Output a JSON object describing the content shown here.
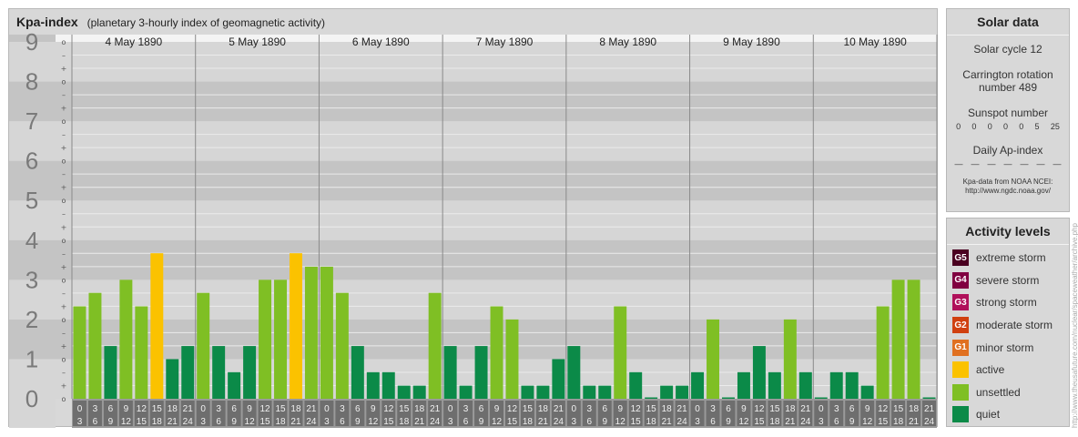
{
  "title": {
    "main": "Kpa-index",
    "sub": "(planetary 3-hourly index of geomagnetic activity)"
  },
  "chart_data": {
    "type": "bar",
    "y_major_labels": [
      "0",
      "1",
      "2",
      "3",
      "4",
      "5",
      "6",
      "7",
      "8",
      "9"
    ],
    "y_minor_labels": [
      "o",
      "+",
      "–"
    ],
    "ylim": [
      0,
      9
    ],
    "days": [
      "4 May 1890",
      "5 May 1890",
      "6 May 1890",
      "7 May 1890",
      "8 May 1890",
      "9 May 1890",
      "10 May 1890"
    ],
    "interval_labels": [
      [
        "0",
        "3"
      ],
      [
        "3",
        "6"
      ],
      [
        "6",
        "9"
      ],
      [
        "9",
        "12"
      ],
      [
        "12",
        "15"
      ],
      [
        "15",
        "18"
      ],
      [
        "18",
        "21"
      ],
      [
        "21",
        "24"
      ]
    ],
    "values": [
      [
        2.33,
        2.67,
        1.33,
        3.0,
        2.33,
        3.67,
        1.0,
        1.33
      ],
      [
        2.67,
        1.33,
        0.67,
        1.33,
        3.0,
        3.0,
        3.67,
        3.33
      ],
      [
        3.33,
        2.67,
        1.33,
        0.67,
        0.67,
        0.33,
        0.33,
        2.67
      ],
      [
        1.33,
        0.33,
        1.33,
        2.33,
        2.0,
        0.33,
        0.33,
        1.0
      ],
      [
        1.33,
        0.33,
        0.33,
        2.33,
        0.67,
        0.0,
        0.33,
        0.33
      ],
      [
        0.67,
        2.0,
        0.0,
        0.67,
        1.33,
        0.67,
        2.0,
        0.67
      ],
      [
        0.0,
        0.67,
        0.67,
        0.33,
        2.33,
        3.0,
        3.0,
        0.0
      ]
    ],
    "level_colors": {
      "quiet": "#0b8a48",
      "unsettled": "#7fbf24",
      "active": "#fbc200",
      "G1": "#e07020",
      "G2": "#d04010",
      "G3": "#b0105a",
      "G4": "#800040",
      "G5": "#4a0020"
    },
    "grid": true
  },
  "solar": {
    "title": "Solar data",
    "solar_cycle": "Solar cycle 12",
    "carrington_line1": "Carrington rotation",
    "carrington_line2": "number 489",
    "sunspot_title": "Sunspot number",
    "sunspot_values": [
      "0",
      "0",
      "0",
      "0",
      "0",
      "5",
      "25"
    ],
    "ap_title": "Daily Ap-index",
    "ap_values": [
      "—",
      "—",
      "—",
      "—",
      "—",
      "—",
      "—"
    ],
    "source_line1": "Kpa-data from NOAA NCEI:",
    "source_line2": "http://www.ngdc.noaa.gov/"
  },
  "activity": {
    "title": "Activity levels",
    "items": [
      {
        "badge": "G5",
        "label": "extreme storm",
        "color": "#4a0020"
      },
      {
        "badge": "G4",
        "label": "severe storm",
        "color": "#800040"
      },
      {
        "badge": "G3",
        "label": "strong storm",
        "color": "#b0105a"
      },
      {
        "badge": "G2",
        "label": "moderate storm",
        "color": "#d04010"
      },
      {
        "badge": "G1",
        "label": "minor storm",
        "color": "#e07020"
      },
      {
        "badge": "",
        "label": "active",
        "color": "#fbc200"
      },
      {
        "badge": "",
        "label": "unsettled",
        "color": "#7fbf24"
      },
      {
        "badge": "",
        "label": "quiet",
        "color": "#0b8a48"
      }
    ]
  },
  "watermark": "http://www.theusafuture.com/nuclear/spaceweather/archive.php"
}
